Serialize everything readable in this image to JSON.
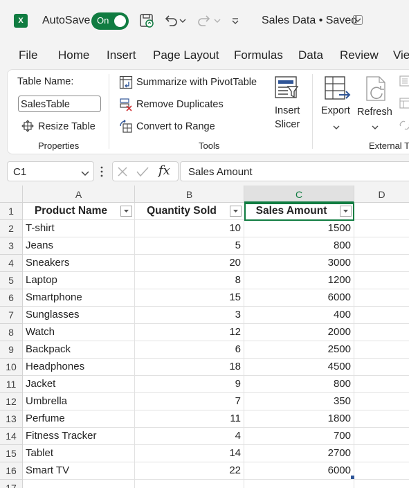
{
  "titlebar": {
    "app_logo": "X",
    "autosave_label": "AutoSave",
    "autosave_toggle": "On",
    "doc_title": "Sales Data • Saved"
  },
  "tabs": [
    "File",
    "Home",
    "Insert",
    "Page Layout",
    "Formulas",
    "Data",
    "Review",
    "Vie"
  ],
  "ribbon": {
    "table_name_label": "Table Name:",
    "table_name_value": "SalesTable",
    "resize_table": "Resize Table",
    "properties_group": "Properties",
    "summarize_pivot": "Summarize with PivotTable",
    "remove_duplicates": "Remove Duplicates",
    "convert_to_range": "Convert to Range",
    "tools_group": "Tools",
    "insert_slicer_1": "Insert",
    "insert_slicer_2": "Slicer",
    "export": "Export",
    "refresh": "Refresh",
    "external_group": "External Ta"
  },
  "formula_bar": {
    "name_box": "C1",
    "fx": "fx",
    "formula": "Sales Amount"
  },
  "sheet": {
    "columns": [
      "A",
      "B",
      "C",
      "D"
    ],
    "active_column": "C",
    "headers": [
      "Product Name",
      "Quantity Sold",
      "Sales Amount"
    ],
    "rows": [
      [
        "T-shirt",
        "10",
        "1500"
      ],
      [
        "Jeans",
        "5",
        "800"
      ],
      [
        "Sneakers",
        "20",
        "3000"
      ],
      [
        "Laptop",
        "8",
        "1200"
      ],
      [
        "Smartphone",
        "15",
        "6000"
      ],
      [
        "Sunglasses",
        "3",
        "400"
      ],
      [
        "Watch",
        "12",
        "2000"
      ],
      [
        "Backpack",
        "6",
        "2500"
      ],
      [
        "Headphones",
        "18",
        "4500"
      ],
      [
        "Jacket",
        "9",
        "800"
      ],
      [
        "Umbrella",
        "7",
        "350"
      ],
      [
        "Perfume",
        "11",
        "1800"
      ],
      [
        "Fitness Tracker",
        "4",
        "700"
      ],
      [
        "Tablet",
        "14",
        "2700"
      ],
      [
        "Smart TV",
        "22",
        "6000"
      ]
    ],
    "row_numbers": [
      "1",
      "2",
      "3",
      "4",
      "5",
      "6",
      "7",
      "8",
      "9",
      "10",
      "11",
      "12",
      "13",
      "14",
      "15",
      "16",
      "17"
    ]
  },
  "colors": {
    "excel_green": "#107c41",
    "accent_blue": "#2f5597"
  }
}
